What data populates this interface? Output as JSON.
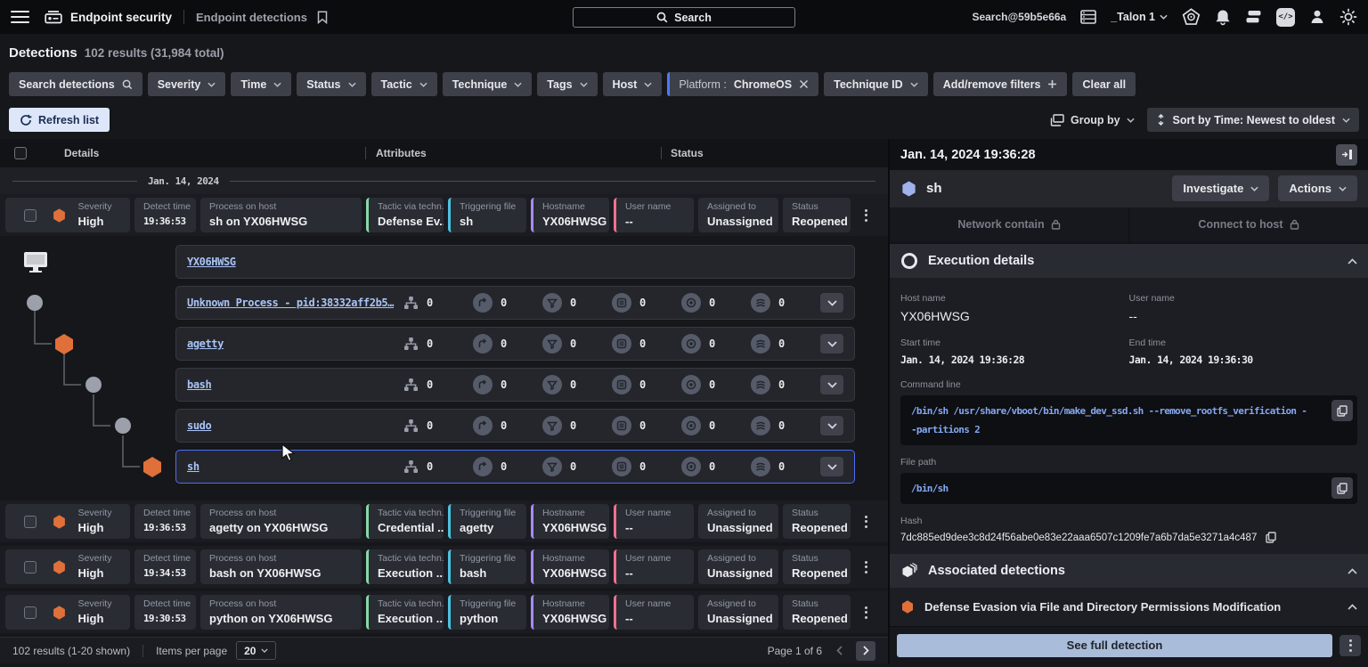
{
  "topbar": {
    "app_title": "Endpoint security",
    "page_title": "Endpoint detections",
    "search_label": "Search",
    "account": "Search@59b5e66a",
    "tenant": "_Talon 1"
  },
  "header": {
    "title": "Detections",
    "summary": "102 results (31,984 total)"
  },
  "filters": {
    "search_label": "Search detections",
    "dropdowns": [
      "Severity",
      "Time",
      "Status",
      "Tactic",
      "Technique",
      "Tags",
      "Host"
    ],
    "active_name": "Platform :",
    "active_value": "ChromeOS",
    "technique_id": "Technique ID",
    "add_remove": "Add/remove filters",
    "clear_all": "Clear all"
  },
  "toolbar": {
    "refresh": "Refresh list",
    "group_by": "Group by",
    "sort": "Sort by Time: Newest to oldest"
  },
  "table": {
    "headers": {
      "details": "Details",
      "attributes": "Attributes",
      "status": "Status"
    },
    "date_group": "Jan. 14, 2024",
    "card_labels": {
      "severity": "Severity",
      "time": "Detect time",
      "process": "Process on host",
      "tactic": "Tactic via techn...",
      "trigger": "Triggering file",
      "hostname": "Hostname",
      "user": "User name",
      "assigned": "Assigned to",
      "status": "Status"
    },
    "rows": [
      {
        "severity": "High",
        "time": "19:36:53",
        "process": "sh on YX06HWSG",
        "tactic": "Defense Ev...",
        "trigger": "sh",
        "hostname": "YX06HWSG",
        "user": "--",
        "assigned": "Unassigned",
        "status": "Reopened"
      },
      {
        "severity": "High",
        "time": "19:36:53",
        "process": "agetty on YX06HWSG",
        "tactic": "Credential ...",
        "trigger": "agetty",
        "hostname": "YX06HWSG",
        "user": "--",
        "assigned": "Unassigned",
        "status": "Reopened"
      },
      {
        "severity": "High",
        "time": "19:34:53",
        "process": "bash on YX06HWSG",
        "tactic": "Execution ...",
        "trigger": "bash",
        "hostname": "YX06HWSG",
        "user": "--",
        "assigned": "Unassigned",
        "status": "Reopened"
      },
      {
        "severity": "High",
        "time": "19:30:53",
        "process": "python on YX06HWSG",
        "tactic": "Execution ...",
        "trigger": "python",
        "hostname": "YX06HWSG",
        "user": "--",
        "assigned": "Unassigned",
        "status": "Reopened"
      }
    ]
  },
  "tree": {
    "host": "YX06HWSG",
    "rows": [
      {
        "name": "Unknown Process - pid:38332aff2b5…",
        "counts": [
          "0",
          "0",
          "0",
          "0",
          "0",
          "0"
        ],
        "selected": false
      },
      {
        "name": "agetty",
        "counts": [
          "0",
          "0",
          "0",
          "0",
          "0",
          "0"
        ],
        "selected": false
      },
      {
        "name": "bash",
        "counts": [
          "0",
          "0",
          "0",
          "0",
          "0",
          "0"
        ],
        "selected": false
      },
      {
        "name": "sudo",
        "counts": [
          "0",
          "0",
          "0",
          "0",
          "0",
          "0"
        ],
        "selected": false
      },
      {
        "name": "sh",
        "counts": [
          "0",
          "0",
          "0",
          "0",
          "0",
          "0"
        ],
        "selected": true
      }
    ]
  },
  "pagination": {
    "results": "102 results (1-20 shown)",
    "per_page_label": "Items per page",
    "per_page": "20",
    "page": "Page 1 of 6"
  },
  "panel": {
    "timestamp": "Jan. 14, 2024 19:36:28",
    "entity": "sh",
    "investigate": "Investigate",
    "actions": "Actions",
    "tab_contain": "Network contain",
    "tab_connect": "Connect to host",
    "exec": {
      "title": "Execution details",
      "host_label": "Host name",
      "host": "YX06HWSG",
      "user_label": "User name",
      "user": "--",
      "start_label": "Start time",
      "start": "Jan. 14, 2024 19:36:28",
      "end_label": "End time",
      "end": "Jan. 14, 2024 19:36:30",
      "cmd_label": "Command line",
      "cmd": "/bin/sh /usr/share/vboot/bin/make_dev_ssd.sh --remove_rootfs_verification --partitions 2",
      "path_label": "File path",
      "path": "/bin/sh",
      "hash_label": "Hash",
      "hash": "7dc885ed9dee3c8d24f56abe0e83e22aaa6507c1209fe7a6b7da5e3271a4c487"
    },
    "assoc": {
      "title": "Associated detections",
      "item": "Defense Evasion via File and Directory Permissions Modification"
    },
    "see_full": "See full detection"
  },
  "colors": {
    "severity_high": "#e0703a",
    "accent_blue": "#4d79f6",
    "entity_hex": "#9fb2ec",
    "tactic_green": "#86d8a8",
    "trigger_cyan": "#4cc3e0",
    "hostname_purple": "#a78bfa",
    "user_pink": "#ef7190"
  }
}
